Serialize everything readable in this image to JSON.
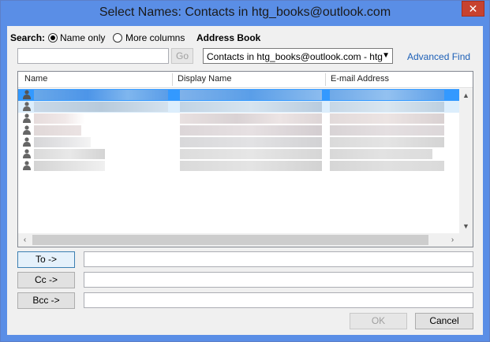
{
  "window": {
    "title": "Select Names: Contacts in htg_books@outlook.com",
    "close_glyph": "✕"
  },
  "search": {
    "label": "Search:",
    "option_name_only": "Name only",
    "option_more_columns": "More columns",
    "selected_option": "Name only",
    "input_value": "",
    "go_label": "Go"
  },
  "address_book": {
    "label": "Address Book",
    "selected": "Contacts in htg_books@outlook.com - htg",
    "advanced_find": "Advanced Find"
  },
  "list": {
    "columns": [
      "Name",
      "Display Name",
      "E-mail Address"
    ],
    "row_count": 7,
    "selected_row": 0,
    "rows_blurred": true
  },
  "recipients": {
    "to_label": "To ->",
    "cc_label": "Cc ->",
    "bcc_label": "Bcc ->",
    "to_value": "",
    "cc_value": "",
    "bcc_value": ""
  },
  "footer": {
    "ok_label": "OK",
    "cancel_label": "Cancel"
  },
  "colors": {
    "title_bar": "#5a8ee6",
    "close_button": "#c7422f",
    "selection": "#3399ff",
    "link": "#1c5fb6"
  }
}
